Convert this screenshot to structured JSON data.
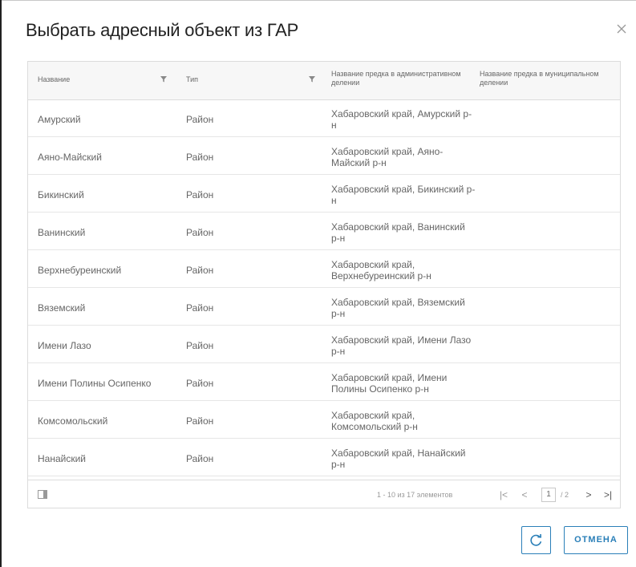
{
  "dialog": {
    "title": "Выбрать адресный объект из ГАР",
    "close_icon": "close-icon"
  },
  "grid": {
    "columns": [
      {
        "label": "Название",
        "filterable": true
      },
      {
        "label": "Тип",
        "filterable": true
      },
      {
        "label": "Название предка в административном делении",
        "filterable": false
      },
      {
        "label": "Название предка в муниципальном делении",
        "filterable": false
      }
    ],
    "rows": [
      {
        "name": "Амурский",
        "type": "Район",
        "admin_parent": "Хабаровский край, Амурский р-н",
        "municipal_parent": ""
      },
      {
        "name": "Аяно-Майский",
        "type": "Район",
        "admin_parent": "Хабаровский край, Аяно-Майский р-н",
        "municipal_parent": ""
      },
      {
        "name": "Бикинский",
        "type": "Район",
        "admin_parent": "Хабаровский край, Бикинский р-н",
        "municipal_parent": ""
      },
      {
        "name": "Ванинский",
        "type": "Район",
        "admin_parent": "Хабаровский край, Ванинский р-н",
        "municipal_parent": ""
      },
      {
        "name": "Верхнебуреинский",
        "type": "Район",
        "admin_parent": "Хабаровский край, Верхнебуреинский р-н",
        "municipal_parent": ""
      },
      {
        "name": "Вяземский",
        "type": "Район",
        "admin_parent": "Хабаровский край, Вяземский р-н",
        "municipal_parent": ""
      },
      {
        "name": "Имени Лазо",
        "type": "Район",
        "admin_parent": "Хабаровский край, Имени Лазо р-н",
        "municipal_parent": ""
      },
      {
        "name": "Имени Полины Осипенко",
        "type": "Район",
        "admin_parent": "Хабаровский край, Имени Полины Осипенко р-н",
        "municipal_parent": ""
      },
      {
        "name": "Комсомольский",
        "type": "Район",
        "admin_parent": "Хабаровский край, Комсомольский р-н",
        "municipal_parent": ""
      },
      {
        "name": "Нанайский",
        "type": "Район",
        "admin_parent": "Хабаровский край, Нанайский р-н",
        "municipal_parent": ""
      }
    ]
  },
  "pager": {
    "info": "1 - 10 из 17 элементов",
    "page": "1",
    "total": "/ 2",
    "first": "|<",
    "prev": "<",
    "next": ">",
    "last": ">|"
  },
  "actions": {
    "refresh_icon": "refresh-icon",
    "cancel_label": "ОТМЕНА"
  },
  "colors": {
    "accent": "#2a7fb8",
    "header_bg": "#f7f7f7",
    "border": "#dcdcdc"
  }
}
